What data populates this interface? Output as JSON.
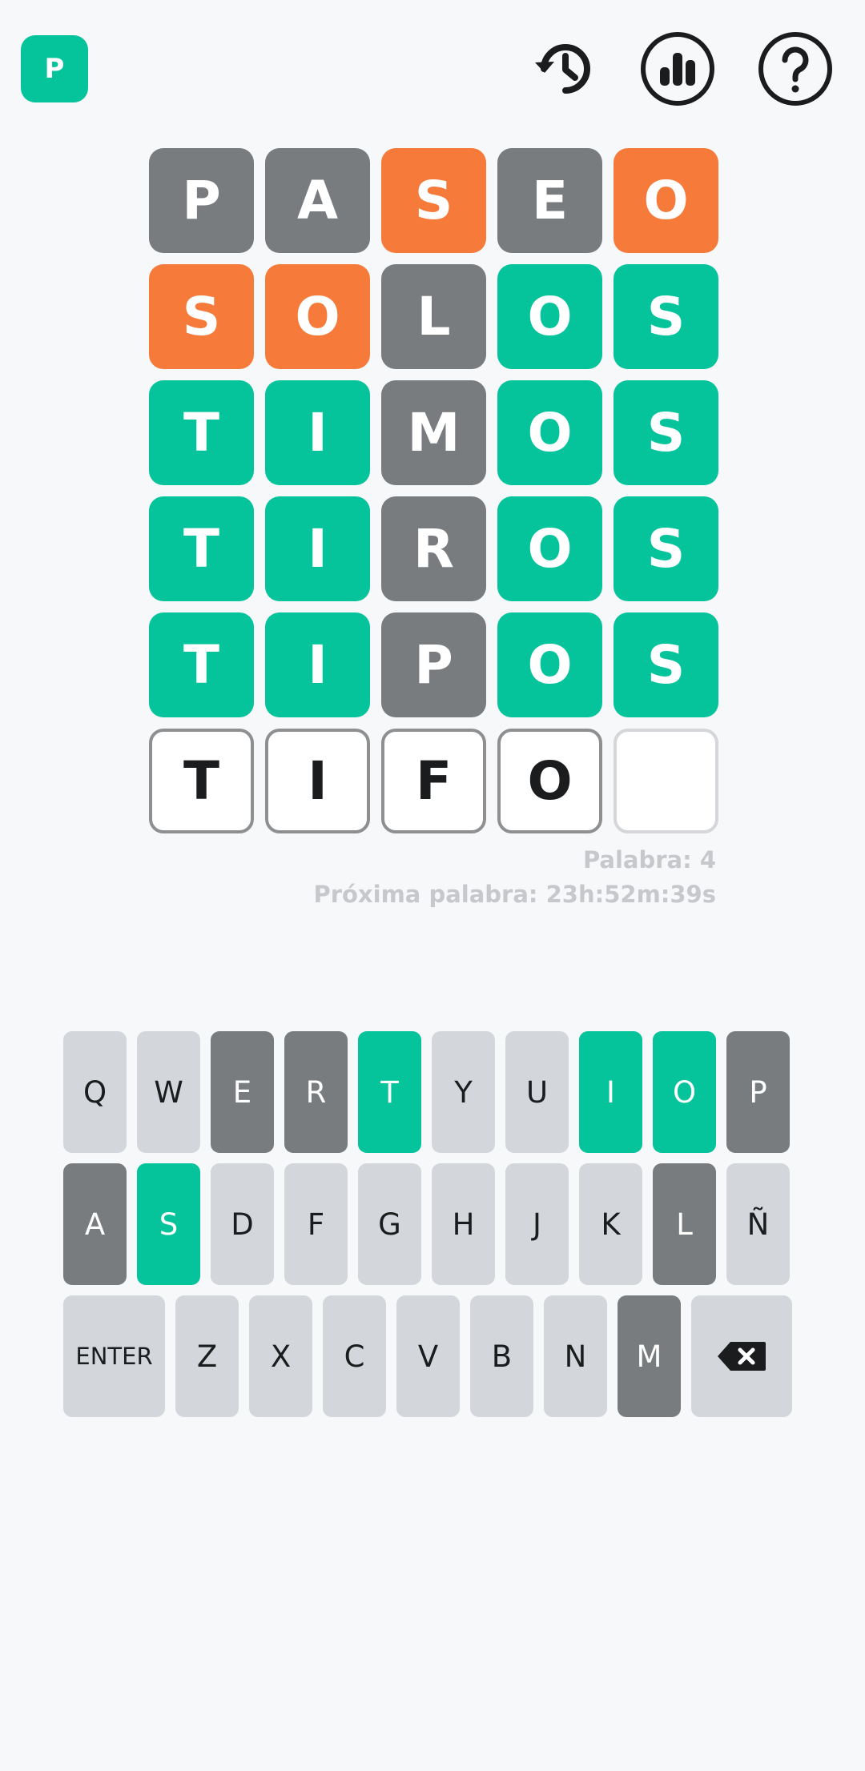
{
  "header": {
    "logo_letter": "P",
    "icons": [
      "history-icon",
      "stats-icon",
      "help-icon"
    ]
  },
  "colors": {
    "correct": "#05c39b",
    "present": "#f67b3a",
    "absent": "#797c7f",
    "key_default": "#d3d6da"
  },
  "board": {
    "rows": [
      [
        {
          "l": "P",
          "s": "absent"
        },
        {
          "l": "A",
          "s": "absent"
        },
        {
          "l": "S",
          "s": "present"
        },
        {
          "l": "E",
          "s": "absent"
        },
        {
          "l": "O",
          "s": "present"
        }
      ],
      [
        {
          "l": "S",
          "s": "present"
        },
        {
          "l": "O",
          "s": "present"
        },
        {
          "l": "L",
          "s": "absent"
        },
        {
          "l": "O",
          "s": "correct"
        },
        {
          "l": "S",
          "s": "correct"
        }
      ],
      [
        {
          "l": "T",
          "s": "correct"
        },
        {
          "l": "I",
          "s": "correct"
        },
        {
          "l": "M",
          "s": "absent"
        },
        {
          "l": "O",
          "s": "correct"
        },
        {
          "l": "S",
          "s": "correct"
        }
      ],
      [
        {
          "l": "T",
          "s": "correct"
        },
        {
          "l": "I",
          "s": "correct"
        },
        {
          "l": "R",
          "s": "absent"
        },
        {
          "l": "O",
          "s": "correct"
        },
        {
          "l": "S",
          "s": "correct"
        }
      ],
      [
        {
          "l": "T",
          "s": "correct"
        },
        {
          "l": "I",
          "s": "correct"
        },
        {
          "l": "P",
          "s": "absent"
        },
        {
          "l": "O",
          "s": "correct"
        },
        {
          "l": "S",
          "s": "correct"
        }
      ],
      [
        {
          "l": "T",
          "s": "filled"
        },
        {
          "l": "I",
          "s": "filled"
        },
        {
          "l": "F",
          "s": "filled"
        },
        {
          "l": "O",
          "s": "filled"
        },
        {
          "l": "",
          "s": "empty"
        }
      ]
    ]
  },
  "info": {
    "word_label": "Palabra: 4",
    "next_word_label": "Próxima palabra: 23h:52m:39s"
  },
  "keyboard": {
    "rows": [
      [
        {
          "k": "Q",
          "s": "default"
        },
        {
          "k": "W",
          "s": "default"
        },
        {
          "k": "E",
          "s": "absent"
        },
        {
          "k": "R",
          "s": "absent"
        },
        {
          "k": "T",
          "s": "correct"
        },
        {
          "k": "Y",
          "s": "default"
        },
        {
          "k": "U",
          "s": "default"
        },
        {
          "k": "I",
          "s": "correct"
        },
        {
          "k": "O",
          "s": "correct"
        },
        {
          "k": "P",
          "s": "absent"
        }
      ],
      [
        {
          "k": "A",
          "s": "absent"
        },
        {
          "k": "S",
          "s": "correct"
        },
        {
          "k": "D",
          "s": "default"
        },
        {
          "k": "F",
          "s": "default"
        },
        {
          "k": "G",
          "s": "default"
        },
        {
          "k": "H",
          "s": "default"
        },
        {
          "k": "J",
          "s": "default"
        },
        {
          "k": "K",
          "s": "default"
        },
        {
          "k": "L",
          "s": "absent"
        },
        {
          "k": "Ñ",
          "s": "default"
        }
      ],
      [
        {
          "k": "ENTER",
          "s": "default",
          "wide": true
        },
        {
          "k": "Z",
          "s": "default"
        },
        {
          "k": "X",
          "s": "default"
        },
        {
          "k": "C",
          "s": "default"
        },
        {
          "k": "V",
          "s": "default"
        },
        {
          "k": "B",
          "s": "default"
        },
        {
          "k": "N",
          "s": "default"
        },
        {
          "k": "M",
          "s": "absent"
        },
        {
          "k": "",
          "s": "default",
          "icon": "backspace-icon"
        }
      ]
    ]
  }
}
